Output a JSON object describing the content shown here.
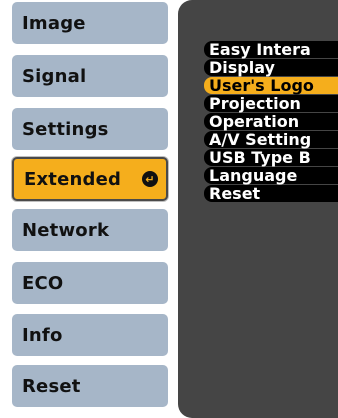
{
  "main_menu": {
    "items": [
      {
        "label": "Image",
        "selected": false
      },
      {
        "label": "Signal",
        "selected": false
      },
      {
        "label": "Settings",
        "selected": false
      },
      {
        "label": "Extended",
        "selected": true,
        "icon": "enter-icon"
      },
      {
        "label": "Network",
        "selected": false
      },
      {
        "label": "ECO",
        "selected": false
      },
      {
        "label": "Info",
        "selected": false
      },
      {
        "label": "Reset",
        "selected": false
      }
    ],
    "enter_glyph": "↵"
  },
  "submenu": {
    "items": [
      {
        "label": "Easy Intera"
      },
      {
        "label": "Display"
      },
      {
        "label": "User's Logo",
        "highlighted": true
      },
      {
        "label": "Projection"
      },
      {
        "label": "Operation"
      },
      {
        "label": "A/V Setting"
      },
      {
        "label": "USB Type B"
      },
      {
        "label": "Language",
        "icon": "globe-icon"
      },
      {
        "label": "Reset"
      }
    ]
  },
  "colors": {
    "menu_button": "#a6b6c8",
    "selected": "#f5ae1c",
    "panel_bg": "#454545",
    "submenu_bg": "#000000",
    "submenu_text": "#ffffff"
  }
}
